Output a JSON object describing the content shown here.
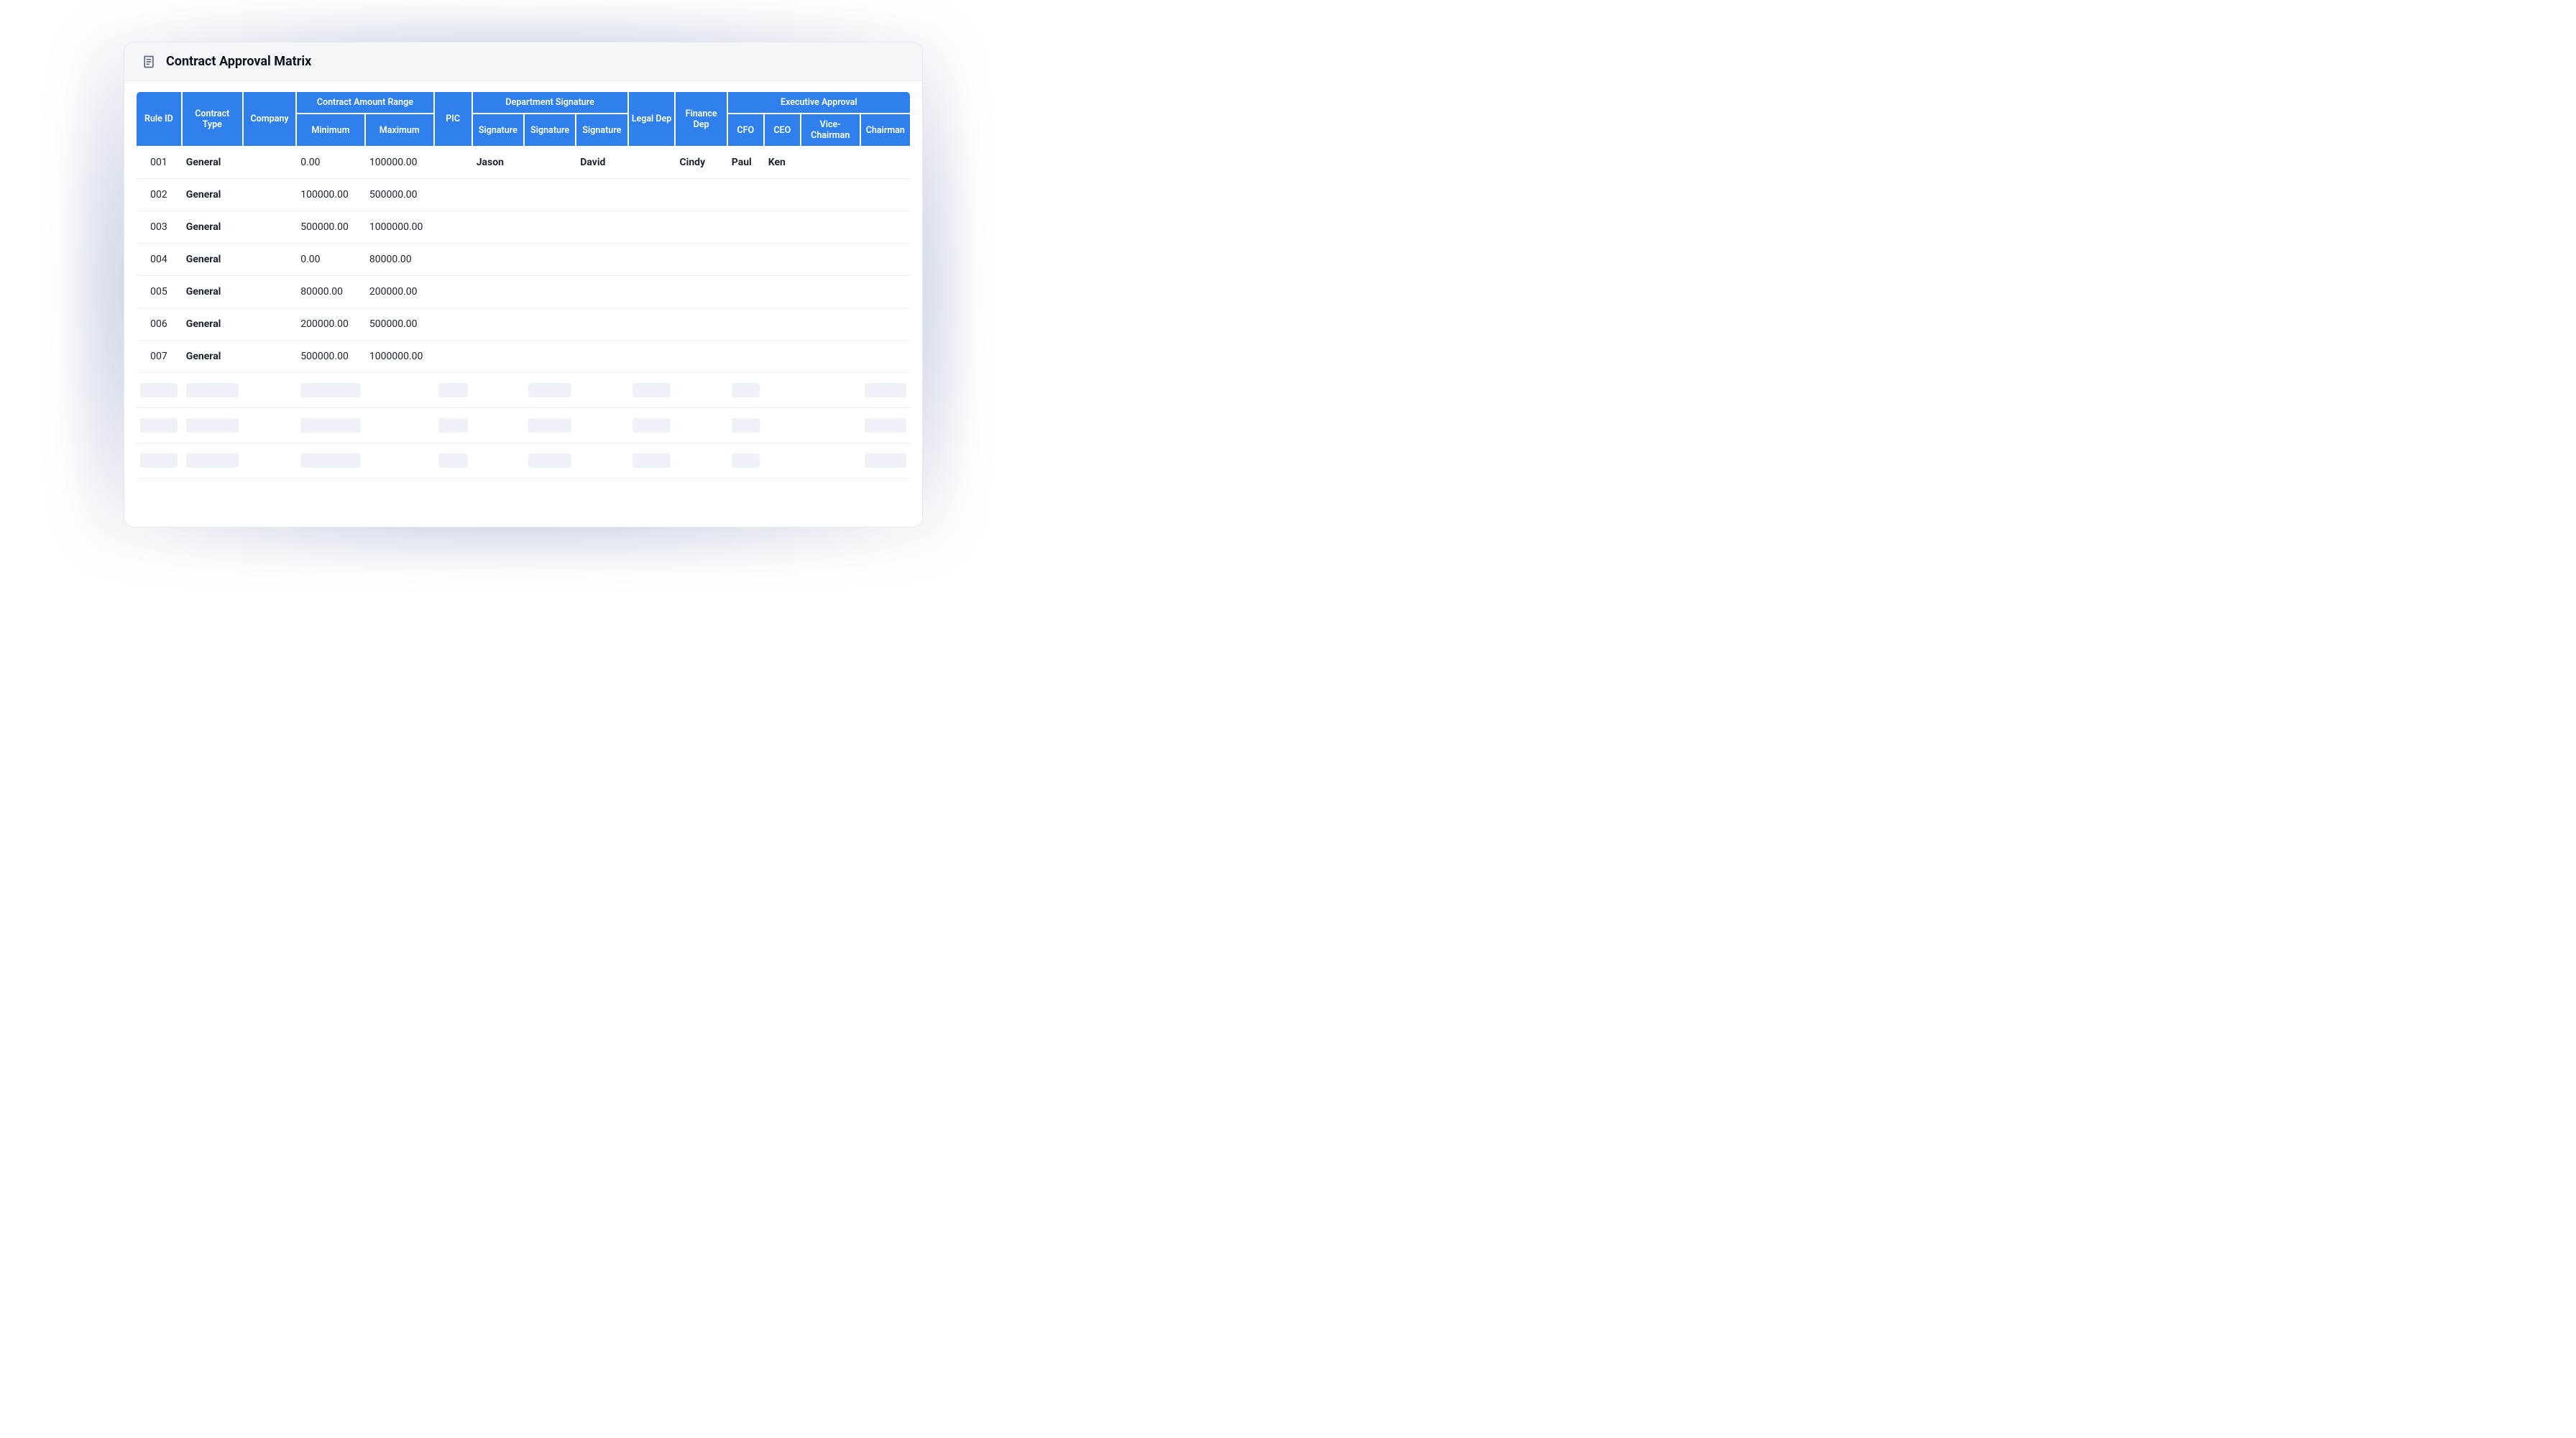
{
  "header": {
    "title": "Contract Approval Matrix"
  },
  "columns": {
    "rule_id": "Rule ID",
    "contract_type": "Contract Type",
    "company": "Company",
    "amount_range": "Contract Amount Range",
    "minimum": "Minimum",
    "maximum": "Maximum",
    "pic": "PIC",
    "dept_signature": "Department Signature",
    "signature": "Signature",
    "legal_dep": "Legal Dep",
    "finance_dep": "Finance Dep",
    "executive_approval": "Executive Approval",
    "cfo": "CFO",
    "ceo": "CEO",
    "vice_chairman": "Vice-Chairman",
    "chairman": "Chairman"
  },
  "rows": [
    {
      "rule_id": "001",
      "contract_type": "General",
      "company": "",
      "minimum": "0.00",
      "maximum": "100000.00",
      "pic": "",
      "sig1": "Jason",
      "sig2": "",
      "sig3": "David",
      "legal": "",
      "finance": "Cindy",
      "cfo": "Paul",
      "ceo": "Ken",
      "vice": "",
      "chairman": ""
    },
    {
      "rule_id": "002",
      "contract_type": "General",
      "company": "",
      "minimum": "100000.00",
      "maximum": "500000.00",
      "pic": "",
      "sig1": "",
      "sig2": "",
      "sig3": "",
      "legal": "",
      "finance": "",
      "cfo": "",
      "ceo": "",
      "vice": "",
      "chairman": ""
    },
    {
      "rule_id": "003",
      "contract_type": "General",
      "company": "",
      "minimum": "500000.00",
      "maximum": "1000000.00",
      "pic": "",
      "sig1": "",
      "sig2": "",
      "sig3": "",
      "legal": "",
      "finance": "",
      "cfo": "",
      "ceo": "",
      "vice": "",
      "chairman": ""
    },
    {
      "rule_id": "004",
      "contract_type": "General",
      "company": "",
      "minimum": "0.00",
      "maximum": "80000.00",
      "pic": "",
      "sig1": "",
      "sig2": "",
      "sig3": "",
      "legal": "",
      "finance": "",
      "cfo": "",
      "ceo": "",
      "vice": "",
      "chairman": ""
    },
    {
      "rule_id": "005",
      "contract_type": "General",
      "company": "",
      "minimum": "80000.00",
      "maximum": "200000.00",
      "pic": "",
      "sig1": "",
      "sig2": "",
      "sig3": "",
      "legal": "",
      "finance": "",
      "cfo": "",
      "ceo": "",
      "vice": "",
      "chairman": ""
    },
    {
      "rule_id": "006",
      "contract_type": "General",
      "company": "",
      "minimum": "200000.00",
      "maximum": "500000.00",
      "pic": "",
      "sig1": "",
      "sig2": "",
      "sig3": "",
      "legal": "",
      "finance": "",
      "cfo": "",
      "ceo": "",
      "vice": "",
      "chairman": ""
    },
    {
      "rule_id": "007",
      "contract_type": "General",
      "company": "",
      "minimum": "500000.00",
      "maximum": "1000000.00",
      "pic": "",
      "sig1": "",
      "sig2": "",
      "sig3": "",
      "legal": "",
      "finance": "",
      "cfo": "",
      "ceo": "",
      "vice": "",
      "chairman": ""
    }
  ],
  "colors": {
    "header_blue": "#2f80ed",
    "panel_bg": "#ffffff",
    "header_bg": "#f5f6f9"
  }
}
